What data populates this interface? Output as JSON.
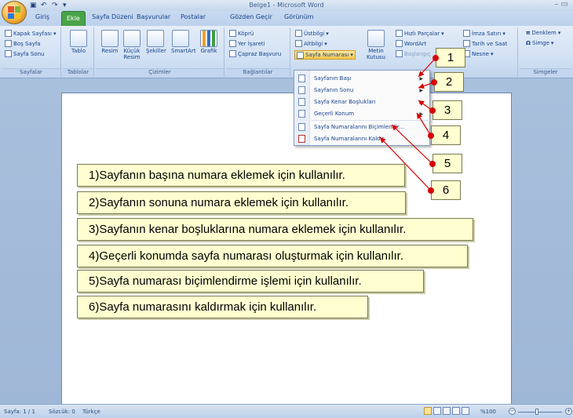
{
  "window": {
    "title": "Belge1 - Microsoft Word",
    "controls": "– ▭"
  },
  "quick_access": [
    "save-icon",
    "undo-icon",
    "redo-icon",
    "customize-icon"
  ],
  "tabs": [
    {
      "label": "Giriş"
    },
    {
      "label": "Ekle",
      "active": true
    },
    {
      "label": "Sayfa Düzeni"
    },
    {
      "label": "Başvurular"
    },
    {
      "label": "Postalar"
    },
    {
      "label": "Gözden Geçir"
    },
    {
      "label": "Görünüm"
    }
  ],
  "ribbon": {
    "sayfalar": {
      "label": "Sayfalar",
      "items": [
        "Kapak Sayfası",
        "Boş Sayfa",
        "Sayfa Sonu"
      ]
    },
    "tablolar": {
      "label": "Tablolar",
      "tablo": "Tablo"
    },
    "cizimler": {
      "label": "Çizimler",
      "items": [
        "Resim",
        "Küçük Resim",
        "Şekiller",
        "SmartArt",
        "Grafik"
      ]
    },
    "baglantilar": {
      "label": "Bağlantılar",
      "items": [
        "Köprü",
        "Yer İşareti",
        "Çapraz Başvuru"
      ]
    },
    "ustbilgi": {
      "items": [
        "Üstbilgi",
        "Altbilgi",
        "Sayfa Numarası"
      ]
    },
    "metin": {
      "metin_kutusu": "Metin Kutusu",
      "items": [
        "Hızlı Parçalar",
        "WordArt",
        "Başlangıç",
        "İmza Satırı",
        "Tarih ve Saat",
        "Nesne"
      ]
    },
    "simgeler": {
      "label": "Simgeler",
      "items": [
        "Denklem",
        "Simge"
      ]
    }
  },
  "menu": {
    "items": [
      {
        "label": "Sayfanın Başı",
        "submenu": true
      },
      {
        "label": "Sayfanın Sonu",
        "submenu": true
      },
      {
        "label": "Sayfa Kenar Boşlukları",
        "submenu": true
      },
      {
        "label": "Geçerli Konum",
        "submenu": true
      },
      {
        "label": "Sayfa Numaralarını Biçimlendir...",
        "submenu": false
      },
      {
        "label": "Sayfa Numaralarını Kaldır",
        "submenu": false
      }
    ]
  },
  "callouts": {
    "numbers": [
      "1",
      "2",
      "3",
      "4",
      "5",
      "6"
    ],
    "explanations": [
      "1)Sayfanın başına numara eklemek için kullanılır.",
      "2)Sayfanın sonuna numara eklemek için kullanılır.",
      "3)Sayfanın kenar boşluklarına numara eklemek için kullanılır.",
      "4)Geçerli konumda sayfa numarası oluşturmak için kullanılır.",
      "5)Sayfa numarası biçimlendirme işlemi için kullanılır.",
      "6)Sayfa numarasını kaldırmak için kullanılır."
    ]
  },
  "statusbar": {
    "page": "Sayfa: 1 / 1",
    "words": "Sözcük: 0",
    "language": "Türkçe",
    "zoom": "%100"
  },
  "colors": {
    "active_tab": "#49a349",
    "callout_fill": "#fffed0",
    "arrow": "#d80000"
  }
}
